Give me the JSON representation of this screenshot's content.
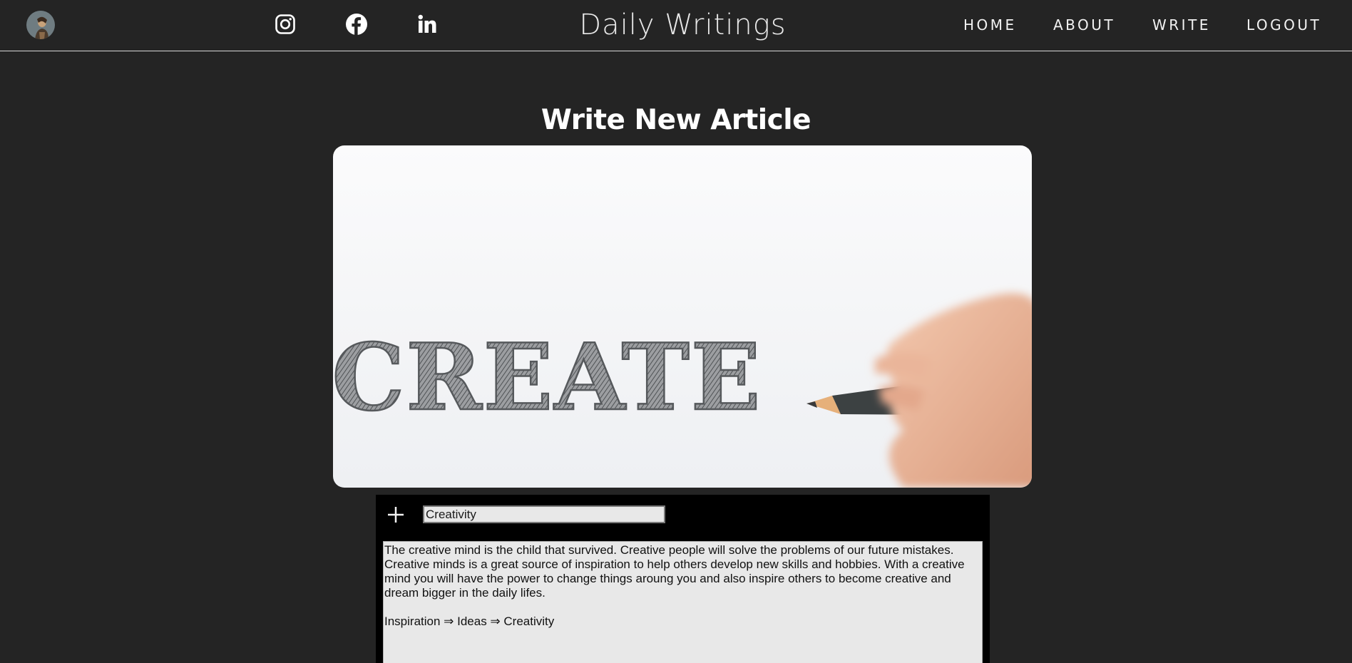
{
  "header": {
    "brand": "Daily Writings",
    "nav": [
      {
        "label": "HOME"
      },
      {
        "label": "ABOUT"
      },
      {
        "label": "WRITE"
      },
      {
        "label": "LOGOUT"
      }
    ],
    "social_icons": [
      "instagram-icon",
      "facebook-icon",
      "linkedin-icon"
    ]
  },
  "main": {
    "page_title": "Write New Article",
    "hero_image": {
      "text": "CREATE"
    },
    "editor": {
      "add_icon": "plus-icon",
      "title_value": "Creativity",
      "body_paragraph_1": "The creative mind is the child that survived. Creative people will solve the problems of our future mistakes. Creative minds is a great source of inspiration to help others develop new skills and hobbies. With a creative mind you will have the power to change things aroung you and also inspire others to become creative and dream bigger in the daily lifes.",
      "body_paragraph_2": "Inspiration ⇒ Ideas ⇒ Creativity"
    }
  },
  "colors": {
    "background": "#242424",
    "editor_bg": "#000000",
    "field_bg": "#e8e8e8",
    "text_light": "#ffffff",
    "spell_underline": "#d40000"
  }
}
